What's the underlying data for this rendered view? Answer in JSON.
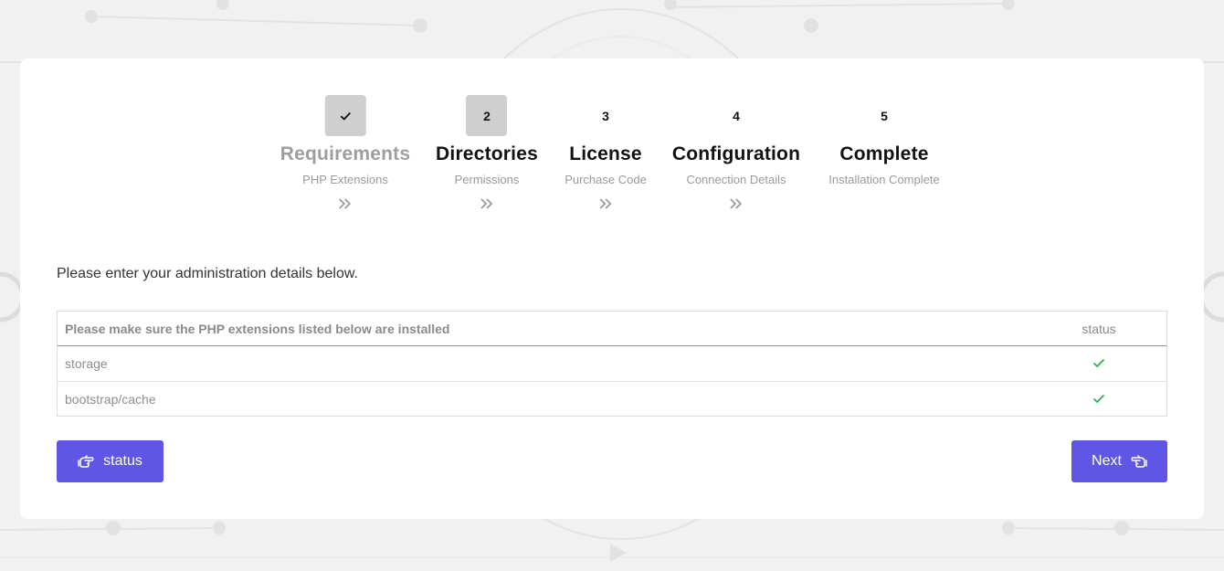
{
  "steps": [
    {
      "number": "",
      "icon": "check-icon",
      "title": "Requirements",
      "subtitle": "PHP Extensions",
      "state": "done"
    },
    {
      "number": "2",
      "title": "Directories",
      "subtitle": "Permissions",
      "state": "active"
    },
    {
      "number": "3",
      "title": "License",
      "subtitle": "Purchase Code",
      "state": "pending"
    },
    {
      "number": "4",
      "title": "Configuration",
      "subtitle": "Connection Details",
      "state": "pending"
    },
    {
      "number": "5",
      "title": "Complete",
      "subtitle": "Installation Complete",
      "state": "pending"
    }
  ],
  "intro": "Please enter your administration details below.",
  "table": {
    "header": {
      "name": "Please make sure the PHP extensions listed below are installed",
      "status": "status"
    },
    "rows": [
      {
        "name": "storage",
        "status": "ok"
      },
      {
        "name": "bootstrap/cache",
        "status": "ok"
      }
    ]
  },
  "buttons": {
    "status": {
      "label": "status",
      "icon": "hand-point-left-icon"
    },
    "next": {
      "label": "Next",
      "icon": "hand-point-right-icon"
    }
  },
  "colors": {
    "accent": "#5f56e6",
    "check": "#2cb24a",
    "badge_bg": "#cfcfcf",
    "page_bg": "#f1f1f1"
  }
}
